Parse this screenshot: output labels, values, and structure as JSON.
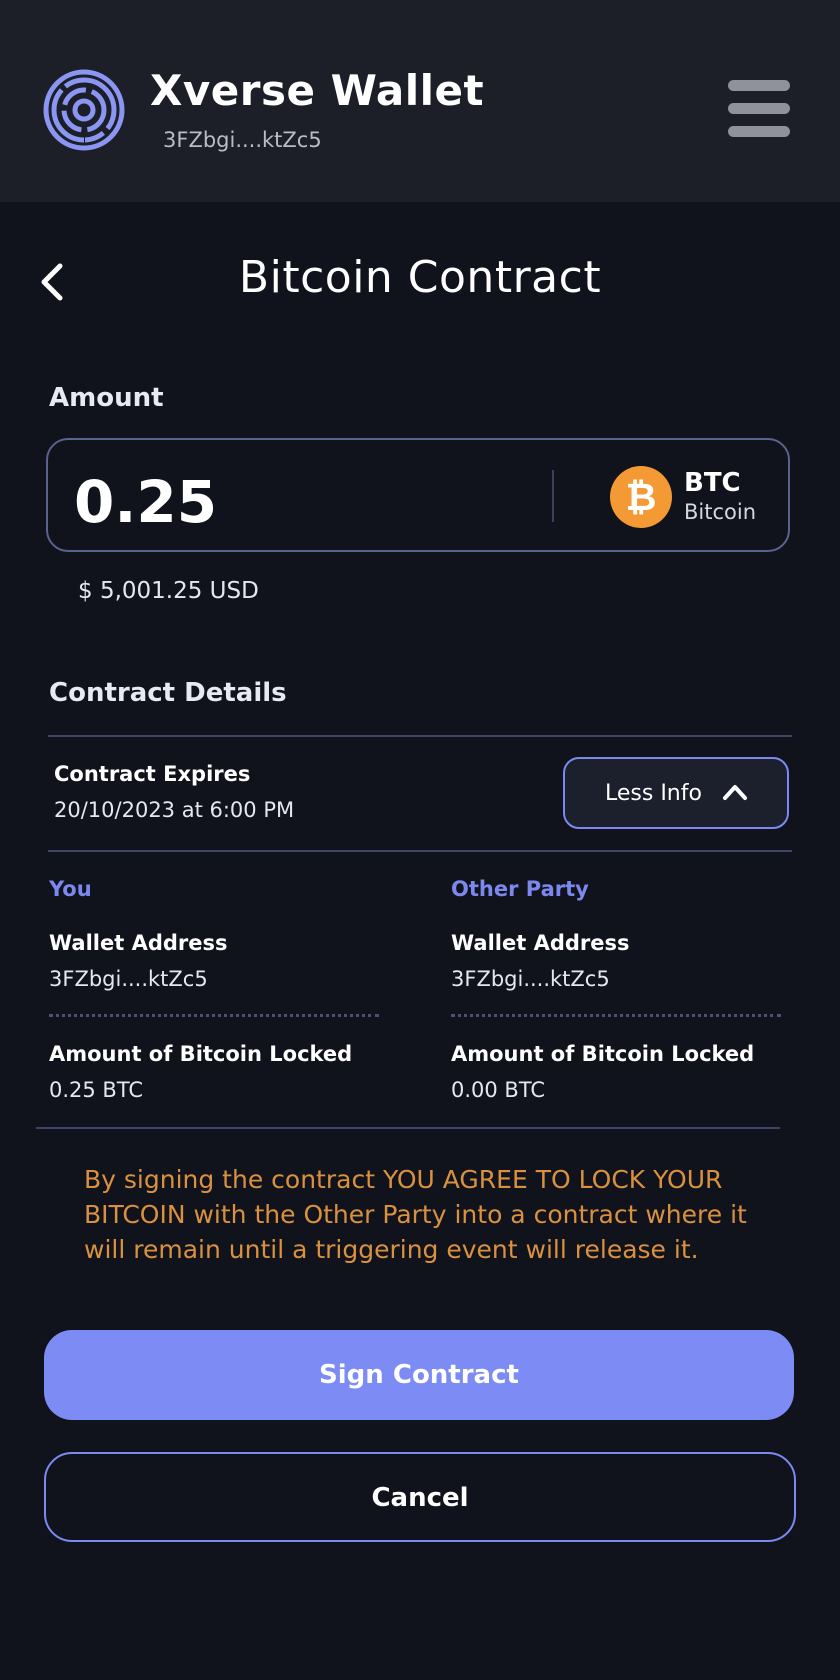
{
  "header": {
    "wallet_name": "Xverse Wallet",
    "wallet_address": "3FZbgi....ktZc5"
  },
  "page": {
    "title": "Bitcoin Contract"
  },
  "amount": {
    "label": "Amount",
    "value": "0.25",
    "currency_code": "BTC",
    "currency_name": "Bitcoin",
    "currency_symbol": "₿",
    "fiat_value": "$ 5,001.25 USD"
  },
  "contract": {
    "section_title": "Contract Details",
    "expires_label": "Contract Expires",
    "expires_value": "20/10/2023 at 6:00 PM",
    "toggle_label": "Less Info"
  },
  "parties": {
    "you": {
      "heading": "You",
      "wallet_label": "Wallet Address",
      "wallet_value": "3FZbgi....ktZc5",
      "locked_label": "Amount of Bitcoin Locked",
      "locked_value": "0.25 BTC"
    },
    "other": {
      "heading": "Other Party",
      "wallet_label": "Wallet Address",
      "wallet_value": "3FZbgi....ktZc5",
      "locked_label": "Amount of Bitcoin Locked",
      "locked_value": "0.00 BTC"
    }
  },
  "notice": {
    "text": "By signing the contract YOU AGREE TO LOCK YOUR BITCOIN with the Other Party into a contract where it will remain until a triggering event will release it."
  },
  "actions": {
    "sign_label": "Sign Contract",
    "cancel_label": "Cancel"
  },
  "colors": {
    "background": "#11131c",
    "header": "#1c1f28",
    "accent": "#7c8cf4",
    "bitcoin": "#f49a34",
    "warning_text": "#d9913f"
  },
  "icons": {
    "logo": "xverse-logo-icon",
    "menu": "hamburger-menu-icon",
    "back": "chevron-left-icon",
    "currency": "bitcoin-icon",
    "toggle": "chevron-up-icon"
  }
}
